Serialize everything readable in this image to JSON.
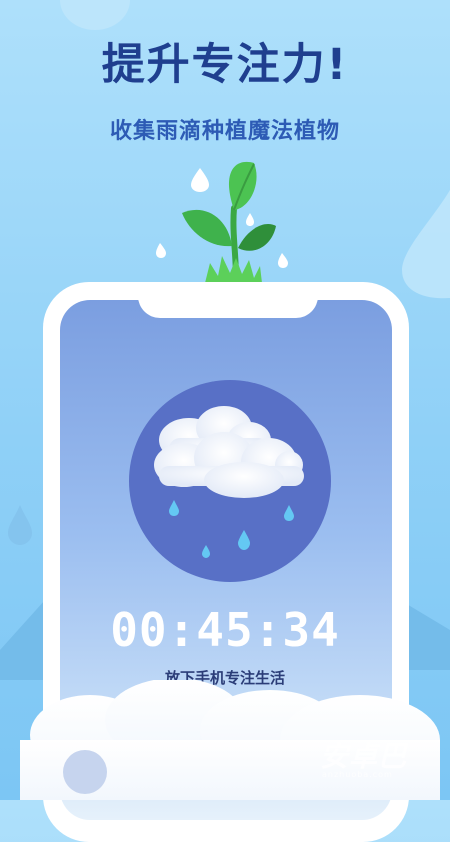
{
  "promo": {
    "headline": "提升专注力!",
    "subheadline": "收集雨滴种植魔法植物"
  },
  "phone_screen": {
    "weather_icon": "rain-cloud-icon",
    "timer": "00:45:34",
    "caption": "放下手机专注生活"
  },
  "watermark": {
    "text": "安卓巴",
    "sub": "anzhuoba.com"
  },
  "colors": {
    "background": "#9fd8f9",
    "headline": "#1f3f8f",
    "circle": "#5870c6",
    "leaf": "#43b94a"
  }
}
